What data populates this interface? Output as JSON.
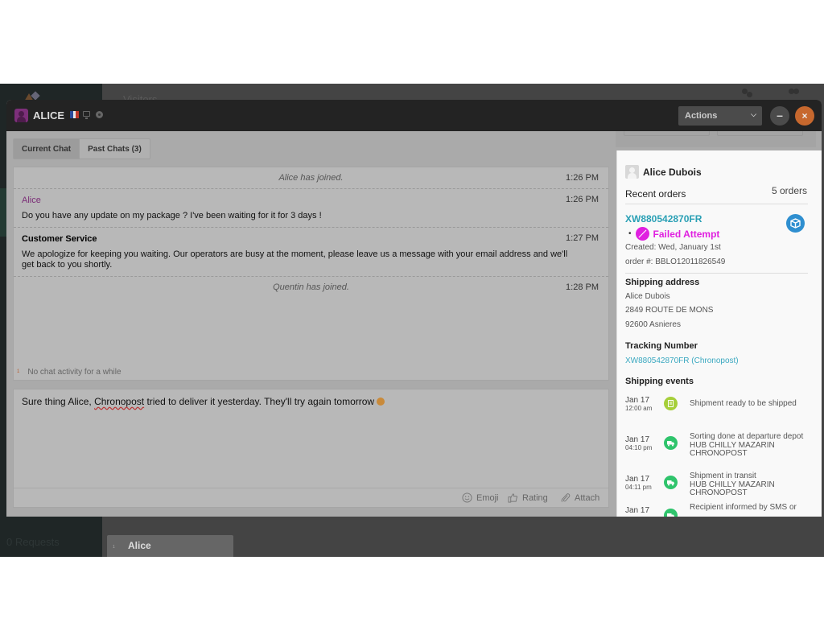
{
  "background_app": {
    "header_title": "Visitors",
    "requests_label": "0 Requests",
    "bottom_tab": {
      "number": "1",
      "name": "Alice"
    }
  },
  "chat_window": {
    "visitor_name": "ALICE",
    "flag_colors": [
      "#2a4a9a",
      "#e8e8e8",
      "#c0392b"
    ],
    "actions_label": "Actions",
    "minimize_label": "–",
    "close_label": "×",
    "accent_close": "#c7682e",
    "tabs": [
      {
        "label": "Current Chat",
        "active": true
      },
      {
        "label": "Past Chats (3)",
        "active": false
      }
    ],
    "messages": [
      {
        "type": "system",
        "text": "Alice has joined.",
        "time": "1:26 PM"
      },
      {
        "type": "message",
        "author": "Alice",
        "author_kind": "visitor",
        "text": "Do you have any update on my package ? I've been waiting for it for 3 days !",
        "time": "1:26 PM"
      },
      {
        "type": "message",
        "author": "Customer Service",
        "author_kind": "agent",
        "text": "We apologize for keeping you waiting. Our operators are busy at the moment, please leave us a message with your email address and we'll get back to you shortly.",
        "time": "1:27 PM"
      },
      {
        "type": "system",
        "text": "Quentin has joined.",
        "time": "1:28 PM"
      }
    ],
    "idle_notice": {
      "marker": "1",
      "text": "No chat activity for a while"
    },
    "composer": {
      "text_before": "Sure thing Alice, ",
      "text_misspelled": "Chronopost",
      "text_after": " tried to deliver it yesterday. They'll try again tomorrow ",
      "tools": [
        {
          "icon": "smiley-icon",
          "label": "Emoji"
        },
        {
          "icon": "thumbs-up-icon",
          "label": "Rating"
        },
        {
          "icon": "paperclip-icon",
          "label": "Attach"
        }
      ]
    }
  },
  "info_panel": {
    "customer_name": "Alice Dubois",
    "recent_orders_label": "Recent orders",
    "orders_count": "5 orders",
    "order": {
      "id": "XW880542870FR",
      "status": "Failed Attempt",
      "status_color": "#e020e0",
      "created": "Created: Wed, January 1st",
      "order_number": "order #: BBLO12011826549"
    },
    "shipping_address": {
      "title": "Shipping address",
      "lines": [
        "Alice Dubois",
        "2849 ROUTE DE MONS",
        "92600 Asnieres"
      ]
    },
    "tracking": {
      "title": "Tracking Number",
      "value": "XW880542870FR (Chronopost)"
    },
    "shipping_events": {
      "title": "Shipping events",
      "events": [
        {
          "date": "Jan 17",
          "time": "12:00 am",
          "icon": "document-icon",
          "lines": [
            "Shipment ready to be shipped"
          ]
        },
        {
          "date": "Jan 17",
          "time": "04:10 pm",
          "icon": "truck-icon",
          "lines": [
            "Sorting done at departure depot",
            "HUB CHILLY MAZARIN",
            "CHRONOPOST"
          ]
        },
        {
          "date": "Jan 17",
          "time": "04:11 pm",
          "icon": "truck-icon",
          "lines": [
            "Shipment in transit",
            "HUB CHILLY MAZARIN",
            "CHRONOPOST"
          ]
        },
        {
          "date": "Jan 17",
          "time": "",
          "icon": "truck-icon",
          "lines": [
            "Recipient informed by SMS or"
          ]
        }
      ]
    }
  }
}
